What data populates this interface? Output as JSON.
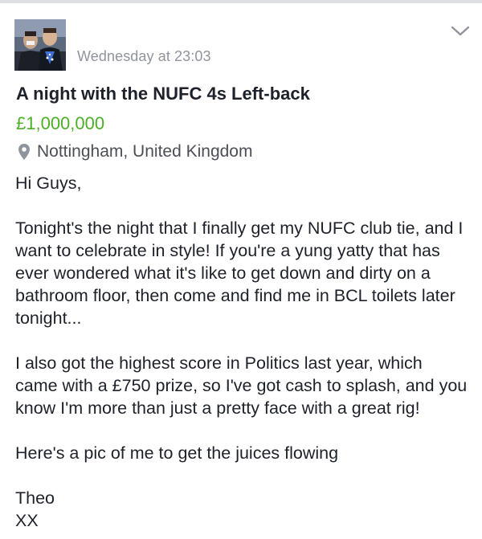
{
  "post": {
    "timestamp": "Wednesday at 23:03",
    "title": "A night with the NUFC 4s Left-back",
    "price": "£1,000,000",
    "location": "Nottingham, United Kingdom",
    "body": {
      "greeting": "Hi Guys,",
      "paragraph1": "Tonight's the night that I finally get my NUFC club tie, and I want to celebrate in style! If you're a yung yatty that has ever wondered what it's like to get down and dirty on a bathroom floor, then come and find me in BCL toilets later tonight...",
      "paragraph2": "I also got the highest score in Politics last year, which came with a £750 prize, so I've got cash to splash, and you know I'm more than just a pretty face with a great rig!",
      "paragraph3": "Here's a pic of me to get the juices flowing",
      "signature_name": "Theo",
      "signature_kisses": "XX"
    }
  },
  "icons": {
    "avatar": "profile-photo",
    "menu": "chevron-down-icon",
    "location": "map-pin-icon"
  },
  "colors": {
    "price": "#4caf27",
    "timestamp": "#90949c",
    "text": "#1d2129",
    "icon": "#90949c"
  }
}
